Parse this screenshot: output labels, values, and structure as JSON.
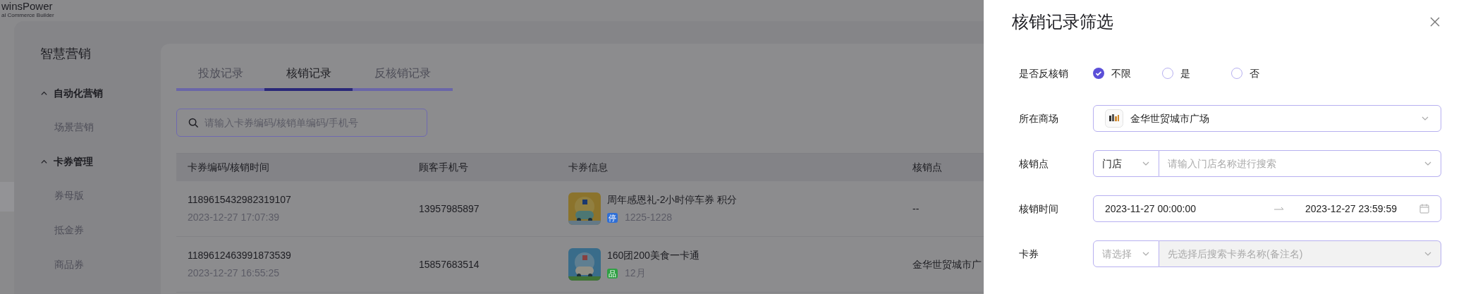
{
  "logo": {
    "name": "winsPower",
    "tagline": "al Commerce Builder"
  },
  "sidebar": {
    "title": "智慧营销",
    "groups": [
      {
        "label": "自动化营销",
        "expanded": true,
        "items": [
          {
            "label": "场景营销"
          }
        ]
      },
      {
        "label": "卡券管理",
        "expanded": true,
        "items": [
          {
            "label": "券母版"
          },
          {
            "label": "抵金券"
          },
          {
            "label": "商品券"
          }
        ]
      }
    ]
  },
  "tabs": [
    {
      "label": "投放记录",
      "selected": false
    },
    {
      "label": "核销记录",
      "selected": true
    },
    {
      "label": "反核销记录",
      "selected": false
    }
  ],
  "search": {
    "placeholder": "请输入卡券编码/核销单编码/手机号"
  },
  "table": {
    "columns": [
      "卡券编码/核销时间",
      "顾客手机号",
      "卡券信息",
      "核销点"
    ],
    "rows": [
      {
        "code": "1189615432982319107",
        "time": "2023-12-27 17:07:39",
        "phone": "13957985897",
        "card_title": "周年感恩礼-2小时停车券 积分",
        "card_tag": "停",
        "color": "#2f6fd6",
        "card_period": "1225-1228",
        "point": "--"
      },
      {
        "code": "1189612463991873539",
        "time": "2023-12-27 16:55:25",
        "phone": "15857683514",
        "card_title": "160团200美食一卡通",
        "card_tag": "品",
        "color": "#2ea043",
        "card_period": "12月",
        "point": "金华世贸城市广"
      }
    ]
  },
  "drawer": {
    "title": "核销记录筛选",
    "fields": [
      {
        "kind": "radio",
        "label": "是否反核销",
        "options": [
          {
            "label": "不限",
            "selected": true
          },
          {
            "label": "是",
            "selected": false
          },
          {
            "label": "否",
            "selected": false
          }
        ]
      },
      {
        "kind": "select",
        "label": "所在商场",
        "value": "金华世贸城市广场"
      },
      {
        "kind": "cascade",
        "label": "核销点",
        "first": {
          "value": "门店"
        },
        "second": {
          "placeholder": "请输入门店名称进行搜索",
          "disabled": false
        }
      },
      {
        "kind": "daterange",
        "label": "核销时间",
        "start": "2023-11-27 00:00:00",
        "end": "2023-12-27 23:59:59"
      },
      {
        "kind": "cascade",
        "label": "卡券",
        "first": {
          "placeholder": "请选择"
        },
        "second": {
          "placeholder": "先选择后搜索卡券名称(备注名)",
          "disabled": true
        }
      }
    ]
  }
}
